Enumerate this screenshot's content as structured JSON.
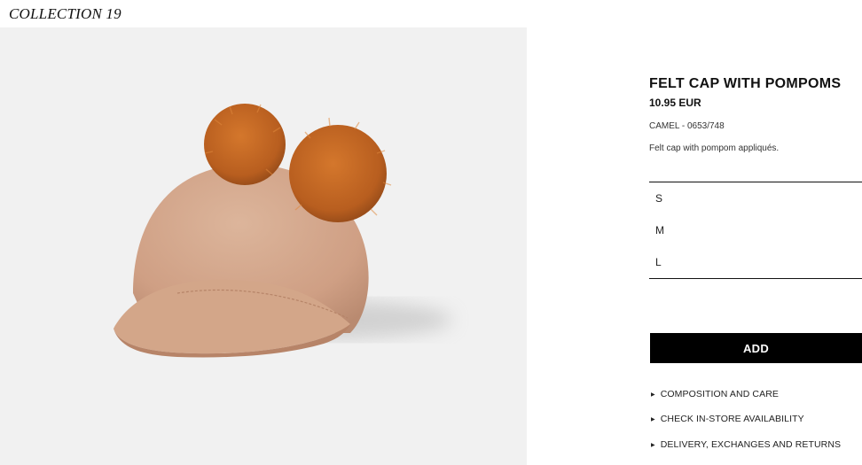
{
  "brand": {
    "collection_label": "COLLECTION 19"
  },
  "product": {
    "title": "FELT CAP WITH POMPOMS",
    "price": "10.95 EUR",
    "color_ref": "CAMEL - 0653/748",
    "description": "Felt cap with pompom appliqués."
  },
  "sizes": [
    "S",
    "M",
    "L"
  ],
  "actions": {
    "add_label": "ADD"
  },
  "info_links": [
    "COMPOSITION AND CARE",
    "CHECK IN-STORE AVAILABILITY",
    "DELIVERY, EXCHANGES AND RETURNS"
  ],
  "colors": {
    "button_bg": "#000000",
    "photo_bg": "#f1f1f1",
    "cap_felt": "#d2a68c",
    "pompom": "#c0631f"
  }
}
